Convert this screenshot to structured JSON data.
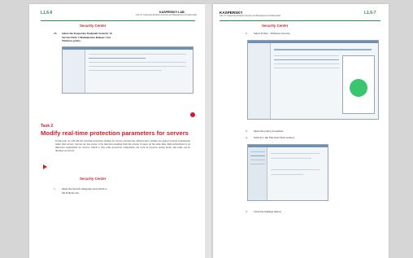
{
  "left_page": {
    "page_number": "L1.6-6",
    "brand": "KASPERSKY LAB",
    "header_subtitle": "Lab 1.6. Kaspersky Endpoint Security and Management Fundamentals",
    "section_center_1": "Security Center",
    "step_23_number": "23.",
    "step_23_line1": "Select the Kaspersky Endpoint Security 10",
    "step_23_line2": "Service Pack 1 Maintenance Release 1 for",
    "step_23_line3": "Windows policy.",
    "task_label": "Task 2",
    "task_title": "Modify real-time protection parameters for servers",
    "task_paragraph": "In this task, we will edit the real-time protection settings for servers, because the default policy settings are geared towards workstations rather than servers. Servers are less prone to the infection resulting from the actions of users. At the same time, high performance is an important requirement for servers, which is why some protection components can work in resource saving mode, and some can be disabled on servers.",
    "section_center_2": "Security Center",
    "step_1_number": "1.",
    "step_1_line1": "Open the Servers subgroup and switch to",
    "step_1_line2": "the Policies tab."
  },
  "right_page": {
    "brand": "KASPERSKY",
    "page_number": "L1.6-7",
    "header_subtitle": "Lab 1.6. Kaspersky Endpoint Security and Management Fundamentals",
    "section_center": "Security Center",
    "step_2": "2.",
    "step_2_text": "Select Policy - Windows Servers.",
    "step_3": "3.",
    "step_3_text": "Open the policy properties.",
    "step_4": "4.",
    "step_4_text": "Switch to the File Anti-Virus section.",
    "step_5": "5.",
    "step_5_text": "Click the Settings button."
  },
  "colors": {
    "accent_red": "#cc1f2d",
    "accent_green": "#2e8b57",
    "chart_green": "#3cc56f"
  }
}
